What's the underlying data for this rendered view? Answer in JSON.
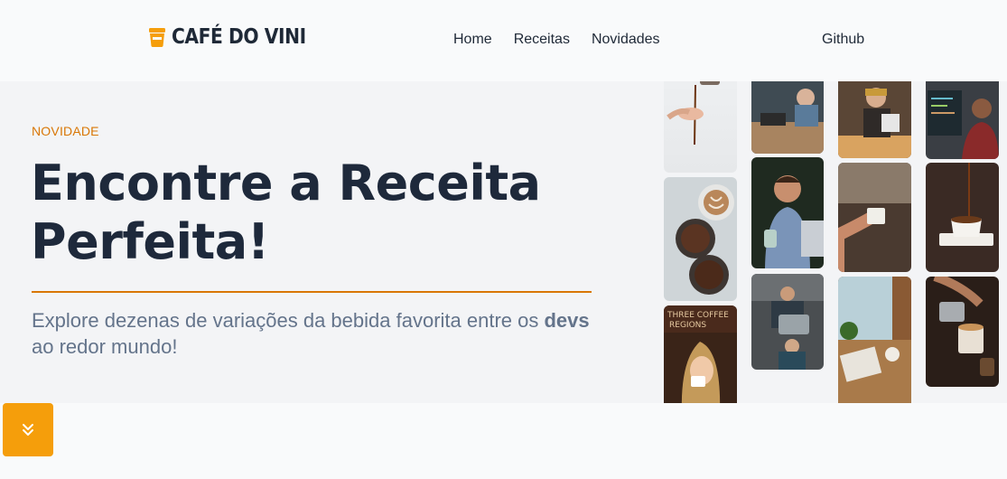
{
  "brand": {
    "name": "CAFÉ DO VINI",
    "accent": "#f59e0b"
  },
  "nav": {
    "items": [
      "Home",
      "Receitas",
      "Novidades"
    ],
    "github": "Github"
  },
  "hero": {
    "kicker": "NOVIDADE",
    "title_line1": "Encontre a Receita",
    "title_line2": "Perfeita!",
    "desc_before": "Explore dezenas de variações da bebida favorita entre os ",
    "desc_bold": "devs",
    "desc_after": " ao redor mundo!",
    "accent": "#d97706"
  },
  "gallery": {
    "photos": [
      "coffee-pour-hand-photo",
      "coffee-shop-table-photo",
      "barista-woman-photo",
      "developer-laptop-photo",
      "latte-beans-photo",
      "smiling-man-laptop-photo",
      "hand-cup-photo",
      "pouring-cup-photo",
      "woman-drinking-coffee-photo",
      "barista-counter-photo",
      "window-table-photo",
      "latte-art-pour-photo"
    ],
    "visible_text": "THREE COFFEE REGIONS"
  },
  "fab": {
    "icon": "chevrons-down-icon"
  }
}
